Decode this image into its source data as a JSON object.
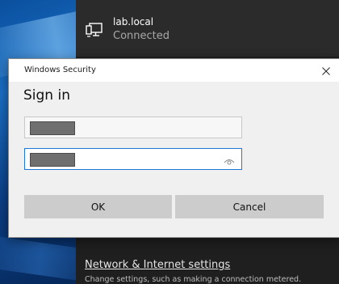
{
  "network": {
    "name": "lab.local",
    "status": "Connected",
    "settings_link": "Network & Internet settings",
    "settings_description": "Change settings, such as making a connection metered."
  },
  "dialog": {
    "title": "Windows Security",
    "heading": "Sign in",
    "ok_label": "OK",
    "cancel_label": "Cancel"
  },
  "icons": {
    "network": "network-computer-icon",
    "close": "close-icon",
    "reveal": "eye-icon"
  },
  "colors": {
    "dialog_bg": "#f0f0f0",
    "button_bg": "#cccccc",
    "focus_border": "#1e78d7",
    "flyout_bg": "#1f1f1f"
  }
}
